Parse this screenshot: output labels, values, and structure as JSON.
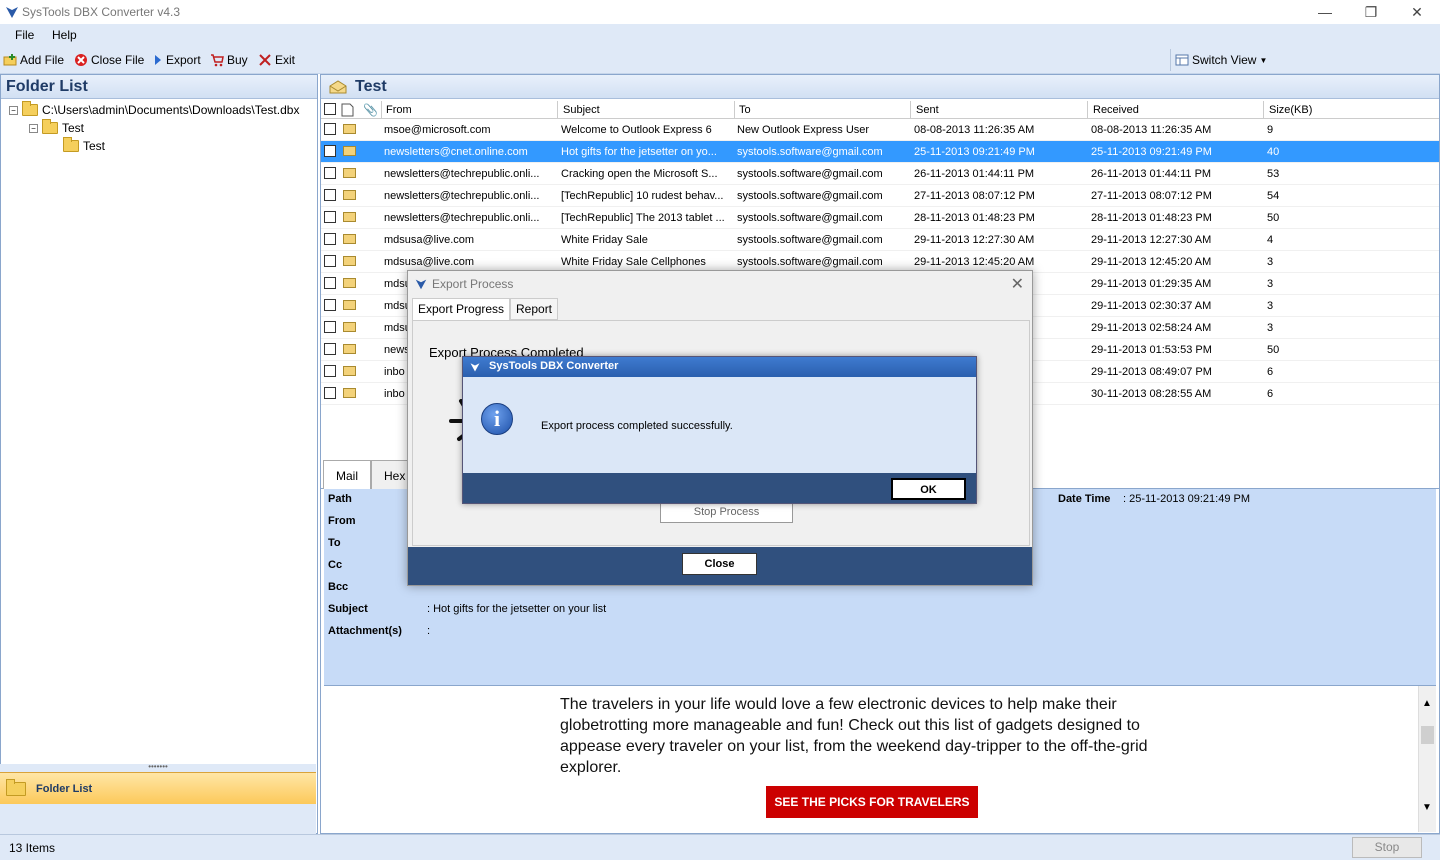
{
  "app": {
    "title": "SysTools DBX Converter v4.3"
  },
  "menu": [
    "File",
    "Help"
  ],
  "toolbar": {
    "add_file": "Add File",
    "close_file": "Close File",
    "export": "Export",
    "buy": "Buy",
    "exit": "Exit",
    "switch_view": "Switch View"
  },
  "left": {
    "header": "Folder List",
    "tree": [
      "C:\\Users\\admin\\Documents\\Downloads\\Test.dbx",
      "Test",
      "Test"
    ],
    "folder_button": "Folder List"
  },
  "right": {
    "header": "Test",
    "columns": [
      "From",
      "Subject",
      "To",
      "Sent",
      "Received",
      "Size(KB)"
    ],
    "rows": [
      {
        "from": "msoe@microsoft.com",
        "subject": "Welcome to Outlook Express 6",
        "to": "New Outlook Express User",
        "sent": "08-08-2013 11:26:35 AM",
        "received": "08-08-2013 11:26:35 AM",
        "size": "9"
      },
      {
        "from": "newsletters@cnet.online.com",
        "subject": "Hot gifts for the jetsetter on yo...",
        "to": "systools.software@gmail.com",
        "sent": "25-11-2013 09:21:49 PM",
        "received": "25-11-2013 09:21:49 PM",
        "size": "40"
      },
      {
        "from": "newsletters@techrepublic.onli...",
        "subject": "Cracking open the Microsoft S...",
        "to": "systools.software@gmail.com",
        "sent": "26-11-2013 01:44:11 PM",
        "received": "26-11-2013 01:44:11 PM",
        "size": "53"
      },
      {
        "from": "newsletters@techrepublic.onli...",
        "subject": "[TechRepublic] 10 rudest behav...",
        "to": "systools.software@gmail.com",
        "sent": "27-11-2013 08:07:12 PM",
        "received": "27-11-2013 08:07:12 PM",
        "size": "54"
      },
      {
        "from": "newsletters@techrepublic.onli...",
        "subject": "[TechRepublic] The 2013 tablet ...",
        "to": "systools.software@gmail.com",
        "sent": "28-11-2013 01:48:23 PM",
        "received": "28-11-2013 01:48:23 PM",
        "size": "50"
      },
      {
        "from": "mdsusa@live.com",
        "subject": "White Friday Sale",
        "to": "systools.software@gmail.com",
        "sent": "29-11-2013 12:27:30 AM",
        "received": "29-11-2013 12:27:30 AM",
        "size": "4"
      },
      {
        "from": "mdsusa@live.com",
        "subject": "White Friday Sale Cellphones",
        "to": "systools.software@gmail.com",
        "sent": "29-11-2013 12:45:20 AM",
        "received": "29-11-2013 12:45:20 AM",
        "size": "3"
      },
      {
        "from": "mdsu",
        "subject": "",
        "to": "",
        "sent": "",
        "received": "29-11-2013 01:29:35 AM",
        "size": "3"
      },
      {
        "from": "mdsu",
        "subject": "",
        "to": "",
        "sent": "",
        "received": "29-11-2013 02:30:37 AM",
        "size": "3"
      },
      {
        "from": "mdsu",
        "subject": "",
        "to": "",
        "sent": "",
        "received": "29-11-2013 02:58:24 AM",
        "size": "3"
      },
      {
        "from": "news",
        "subject": "",
        "to": "",
        "sent": "",
        "received": "29-11-2013 01:53:53 PM",
        "size": "50"
      },
      {
        "from": "inbo",
        "subject": "",
        "to": "",
        "sent": "",
        "received": "29-11-2013 08:49:07 PM",
        "size": "6"
      },
      {
        "from": "inbo",
        "subject": "",
        "to": "",
        "sent": "",
        "received": "30-11-2013 08:28:55 AM",
        "size": "6"
      }
    ],
    "tabs": [
      "Mail",
      "Hex"
    ],
    "details": {
      "labels": [
        "Path",
        "From",
        "To",
        "Cc",
        "Bcc",
        "Subject",
        "Attachment(s)"
      ],
      "subject_value": ": Hot gifts for the jetsetter on your list",
      "attach_value": ":",
      "datetime_label": "Date Time",
      "datetime_value": ":  25-11-2013 09:21:49 PM"
    },
    "body_text": "The travelers in your life would love a few electronic devices to help make their globetrotting more manageable and fun! Check out this list of gadgets designed to appease every traveler on your list, from the weekend day-tripper to the off-the-grid explorer.",
    "picks_button": "SEE THE PICKS FOR TRAVELERS"
  },
  "status": {
    "items": "13 Items",
    "stop": "Stop"
  },
  "export_dialog": {
    "title": "Export Process",
    "tabs": [
      "Export Progress",
      "Report"
    ],
    "message": "Export Process Completed",
    "stop_button": "Stop Process",
    "close_button": "Close"
  },
  "msgbox": {
    "title": "SysTools DBX Converter",
    "message": "Export process completed successfully.",
    "ok": "OK"
  }
}
